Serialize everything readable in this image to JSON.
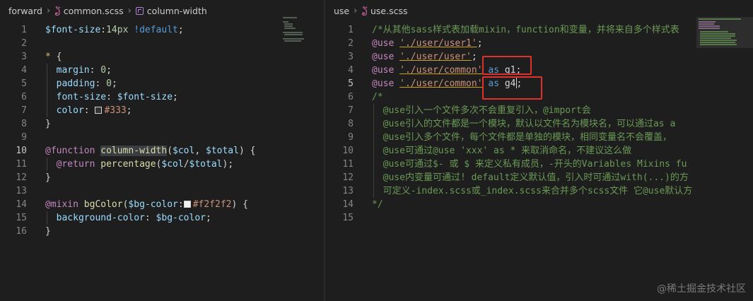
{
  "left": {
    "breadcrumb": {
      "folder": "forward",
      "file": "common.scss",
      "symbol": "column-width"
    },
    "active_line": "10",
    "lines": [
      {
        "n": "1",
        "parts": [
          [
            "var",
            "$font-size"
          ],
          [
            "punc",
            ":"
          ],
          [
            "num",
            "14px"
          ],
          [
            "plain",
            " "
          ],
          [
            "imp",
            "!default"
          ],
          [
            "punc",
            ";"
          ]
        ]
      },
      {
        "n": "2",
        "parts": []
      },
      {
        "n": "3",
        "parts": [
          [
            "sel",
            "*"
          ],
          [
            "plain",
            " "
          ],
          [
            "punc",
            "{"
          ]
        ]
      },
      {
        "n": "4",
        "parts": [
          [
            "plain",
            "  "
          ],
          [
            "prop",
            "margin"
          ],
          [
            "punc",
            ": "
          ],
          [
            "num",
            "0"
          ],
          [
            "punc",
            ";"
          ]
        ]
      },
      {
        "n": "5",
        "parts": [
          [
            "plain",
            "  "
          ],
          [
            "prop",
            "padding"
          ],
          [
            "punc",
            ": "
          ],
          [
            "num",
            "0"
          ],
          [
            "punc",
            ";"
          ]
        ]
      },
      {
        "n": "6",
        "parts": [
          [
            "plain",
            "  "
          ],
          [
            "prop",
            "font-size"
          ],
          [
            "punc",
            ": "
          ],
          [
            "var",
            "$font-size"
          ],
          [
            "punc",
            ";"
          ]
        ]
      },
      {
        "n": "7",
        "parts": [
          [
            "plain",
            "  "
          ],
          [
            "prop",
            "color"
          ],
          [
            "punc",
            ": "
          ],
          [
            "swatch",
            "#333"
          ],
          [
            "str",
            "#333"
          ],
          [
            "punc",
            ";"
          ]
        ]
      },
      {
        "n": "8",
        "parts": [
          [
            "punc",
            "}"
          ]
        ]
      },
      {
        "n": "9",
        "parts": []
      },
      {
        "n": "10",
        "parts": [
          [
            "at",
            "@function"
          ],
          [
            "plain",
            " "
          ],
          [
            "fnhl",
            "column-width"
          ],
          [
            "punc",
            "("
          ],
          [
            "var",
            "$col"
          ],
          [
            "punc",
            ", "
          ],
          [
            "var",
            "$total"
          ],
          [
            "punc",
            ") {"
          ]
        ]
      },
      {
        "n": "11",
        "parts": [
          [
            "plain",
            "  "
          ],
          [
            "at",
            "@return"
          ],
          [
            "plain",
            " "
          ],
          [
            "fn",
            "percentage"
          ],
          [
            "punc",
            "("
          ],
          [
            "var",
            "$col"
          ],
          [
            "punc",
            "/"
          ],
          [
            "var",
            "$total"
          ],
          [
            "punc",
            ");"
          ]
        ]
      },
      {
        "n": "12",
        "parts": [
          [
            "punc",
            "}"
          ]
        ]
      },
      {
        "n": "13",
        "parts": []
      },
      {
        "n": "14",
        "parts": [
          [
            "at",
            "@mixin"
          ],
          [
            "plain",
            " "
          ],
          [
            "fn",
            "bgColor"
          ],
          [
            "punc",
            "("
          ],
          [
            "var",
            "$bg-color"
          ],
          [
            "punc",
            ":"
          ],
          [
            "swatch",
            "#f2f2f2"
          ],
          [
            "str",
            "#f2f2f2"
          ],
          [
            "punc",
            ") {"
          ]
        ]
      },
      {
        "n": "15",
        "parts": [
          [
            "plain",
            "  "
          ],
          [
            "prop",
            "background-color"
          ],
          [
            "punc",
            ": "
          ],
          [
            "var",
            "$bg-color"
          ],
          [
            "punc",
            ";"
          ]
        ]
      },
      {
        "n": "16",
        "parts": [
          [
            "punc",
            "}"
          ]
        ]
      }
    ]
  },
  "right": {
    "breadcrumb": {
      "folder": "use",
      "file": "use.scss"
    },
    "active_line": "5",
    "lines": [
      {
        "n": "1",
        "parts": [
          [
            "cmt",
            "/*从其他sass样式表加载mixin，function和变量，并将来自多个样式表"
          ]
        ]
      },
      {
        "n": "2",
        "parts": [
          [
            "at",
            "@use"
          ],
          [
            "plain",
            " "
          ],
          [
            "strul",
            "'./user/user1'"
          ],
          [
            "punc",
            ";"
          ]
        ]
      },
      {
        "n": "3",
        "parts": [
          [
            "at",
            "@use"
          ],
          [
            "plain",
            " "
          ],
          [
            "strul",
            "'./user/user'"
          ],
          [
            "punc",
            ";"
          ]
        ]
      },
      {
        "n": "4",
        "parts": [
          [
            "at",
            "@use"
          ],
          [
            "plain",
            " "
          ],
          [
            "strul",
            "'./user/common'"
          ],
          [
            "plain",
            " "
          ],
          [
            "kw",
            "as"
          ],
          [
            "plain",
            " "
          ],
          [
            "plain",
            "g1"
          ],
          [
            "punc",
            ";"
          ]
        ]
      },
      {
        "n": "5",
        "parts": [
          [
            "at",
            "@use"
          ],
          [
            "plain",
            " "
          ],
          [
            "strul",
            "'./user/common'"
          ],
          [
            "plain",
            " "
          ],
          [
            "kw",
            "as"
          ],
          [
            "plain",
            " "
          ],
          [
            "plain",
            "g4"
          ],
          [
            "cursor",
            ""
          ],
          [
            "punc",
            ";"
          ]
        ]
      },
      {
        "n": "6",
        "parts": [
          [
            "cmt",
            "/*"
          ]
        ]
      },
      {
        "n": "7",
        "parts": [
          [
            "cmt",
            "  @use引入一个文件多次不会重复引入，@import会"
          ]
        ]
      },
      {
        "n": "8",
        "parts": [
          [
            "cmt",
            "  @use引入的文件都是一个模块，默认以文件名为模块名，可以通过as a"
          ]
        ]
      },
      {
        "n": "9",
        "parts": [
          [
            "cmt",
            "  @use引入多个文件，每个文件都是单独的模块，相同变量名不会覆盖，"
          ]
        ]
      },
      {
        "n": "10",
        "parts": [
          [
            "cmt",
            "  @use可通过@use 'xxx' as * 来取消命名，不建议这么做"
          ]
        ]
      },
      {
        "n": "11",
        "parts": [
          [
            "cmt",
            "  @use可通过$- 或 $ 来定义私有成员，-开头的Variables Mixins fu"
          ]
        ]
      },
      {
        "n": "12",
        "parts": [
          [
            "cmt",
            "  @use内变量可通过! default定义默认值，引入时可通过with(...)的方"
          ]
        ]
      },
      {
        "n": "13",
        "parts": [
          [
            "cmt",
            "  可定义-index.scss或_index.scss来合并多个scss文件 它@use默认方"
          ]
        ]
      },
      {
        "n": "14",
        "parts": [
          [
            "cmt",
            "*/"
          ]
        ]
      },
      {
        "n": "15",
        "parts": []
      }
    ]
  },
  "watermark": "@稀土掘金技术社区"
}
